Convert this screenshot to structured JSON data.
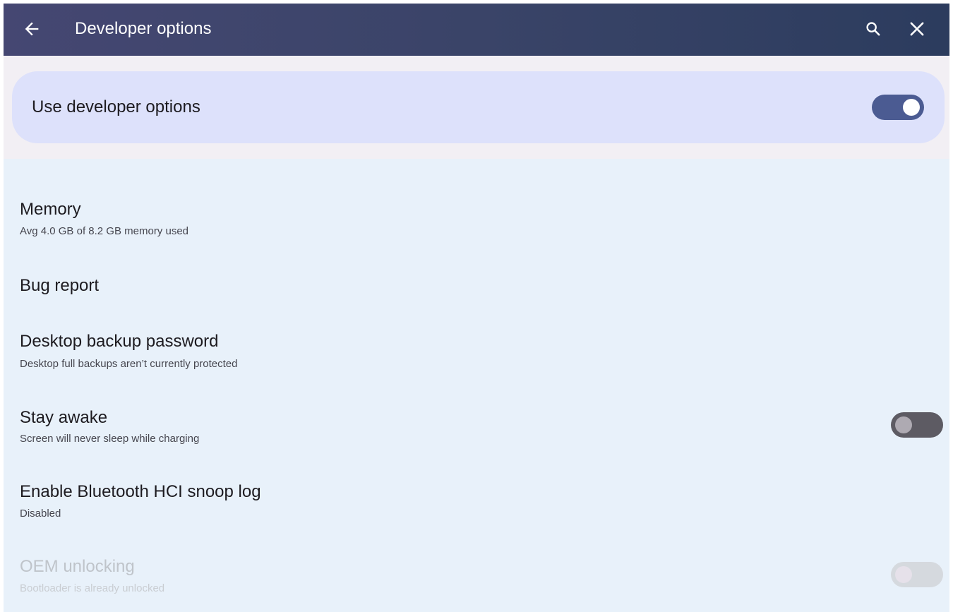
{
  "app_bar": {
    "title": "Developer options",
    "back_icon": "arrow-back-icon",
    "search_icon": "search-icon",
    "close_icon": "close-icon",
    "gradient_colors": [
      "#454772",
      "#2c3c5e"
    ]
  },
  "master_switch": {
    "label": "Use developer options",
    "enabled": true
  },
  "settings": [
    {
      "title": "Memory",
      "summary": "Avg 4.0 GB of 8.2 GB memory used"
    },
    {
      "title": "Bug report"
    },
    {
      "title": "Desktop backup password",
      "summary": "Desktop full backups aren’t currently protected"
    },
    {
      "title": "Stay awake",
      "summary": "Screen will never sleep while charging",
      "toggle": false
    },
    {
      "title": "Enable Bluetooth HCI snoop log",
      "summary": "Disabled"
    },
    {
      "title": "OEM unlocking",
      "summary": "Bootloader is already unlocked",
      "toggle": false,
      "disabled": true
    }
  ],
  "colors": {
    "accent": "#4b5b92",
    "master_card": "#dde1fb",
    "list_background": "#e8f1fa",
    "header_band": "#f2eff4"
  }
}
